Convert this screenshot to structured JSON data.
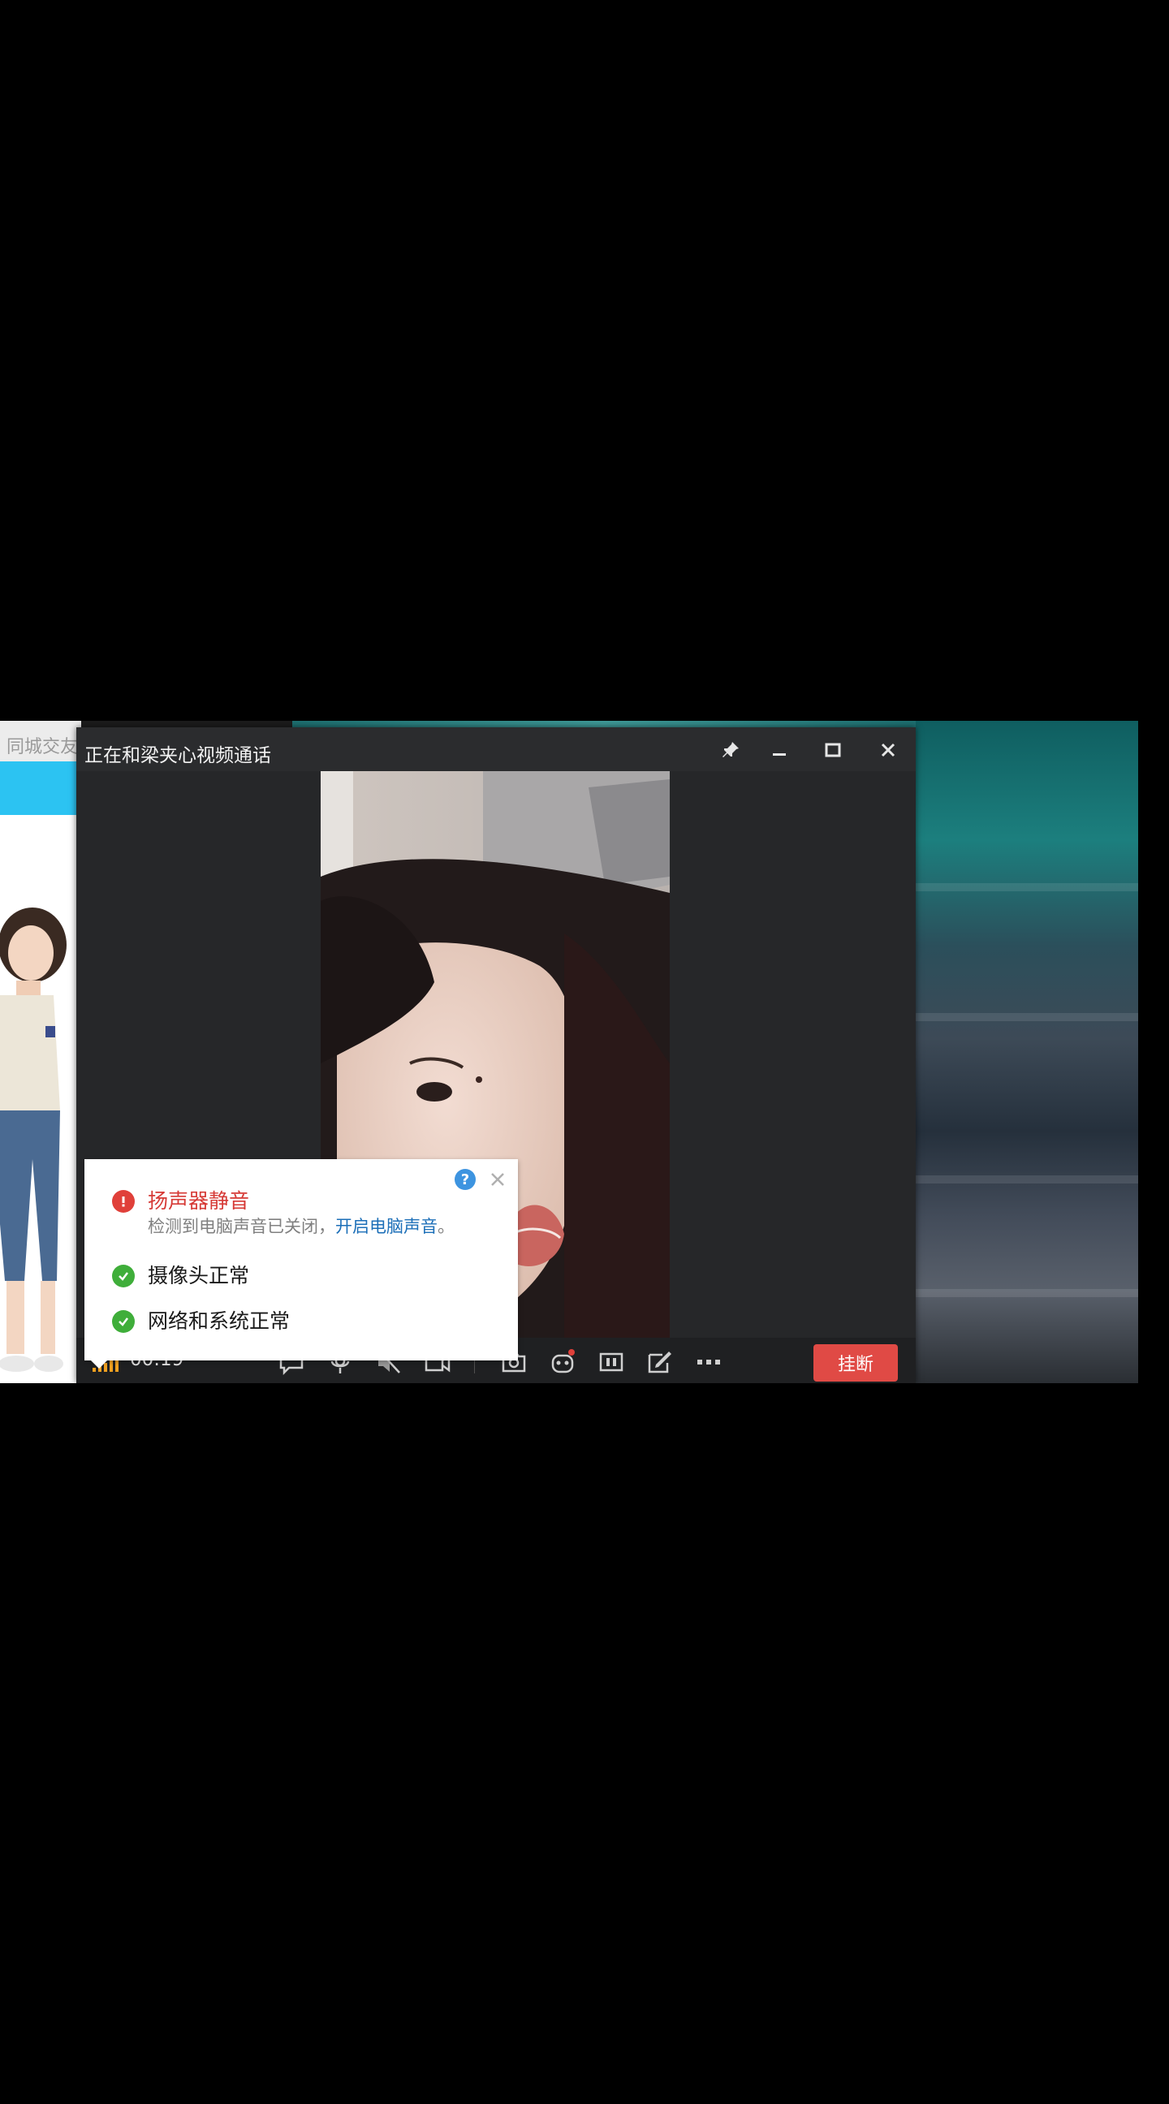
{
  "background_app": {
    "title": "同城交友"
  },
  "call_window": {
    "title": "正在和梁夹心视频通话"
  },
  "control_bar": {
    "timer": "00:19",
    "hangup_label": "挂断"
  },
  "status_popup": {
    "help_label": "?",
    "speaker": {
      "title": "扬声器静音",
      "desc": "检测到电脑声音已关闭，",
      "link": "开启电脑声音",
      "suffix": "。"
    },
    "camera": {
      "title": "摄像头正常"
    },
    "network": {
      "title": "网络和系统正常"
    }
  },
  "colors": {
    "hangup": "#e04a45",
    "link": "#1c6fb8",
    "error": "#d63a36",
    "ok": "#3fae3a",
    "accent_blue": "#2cc3f2"
  }
}
